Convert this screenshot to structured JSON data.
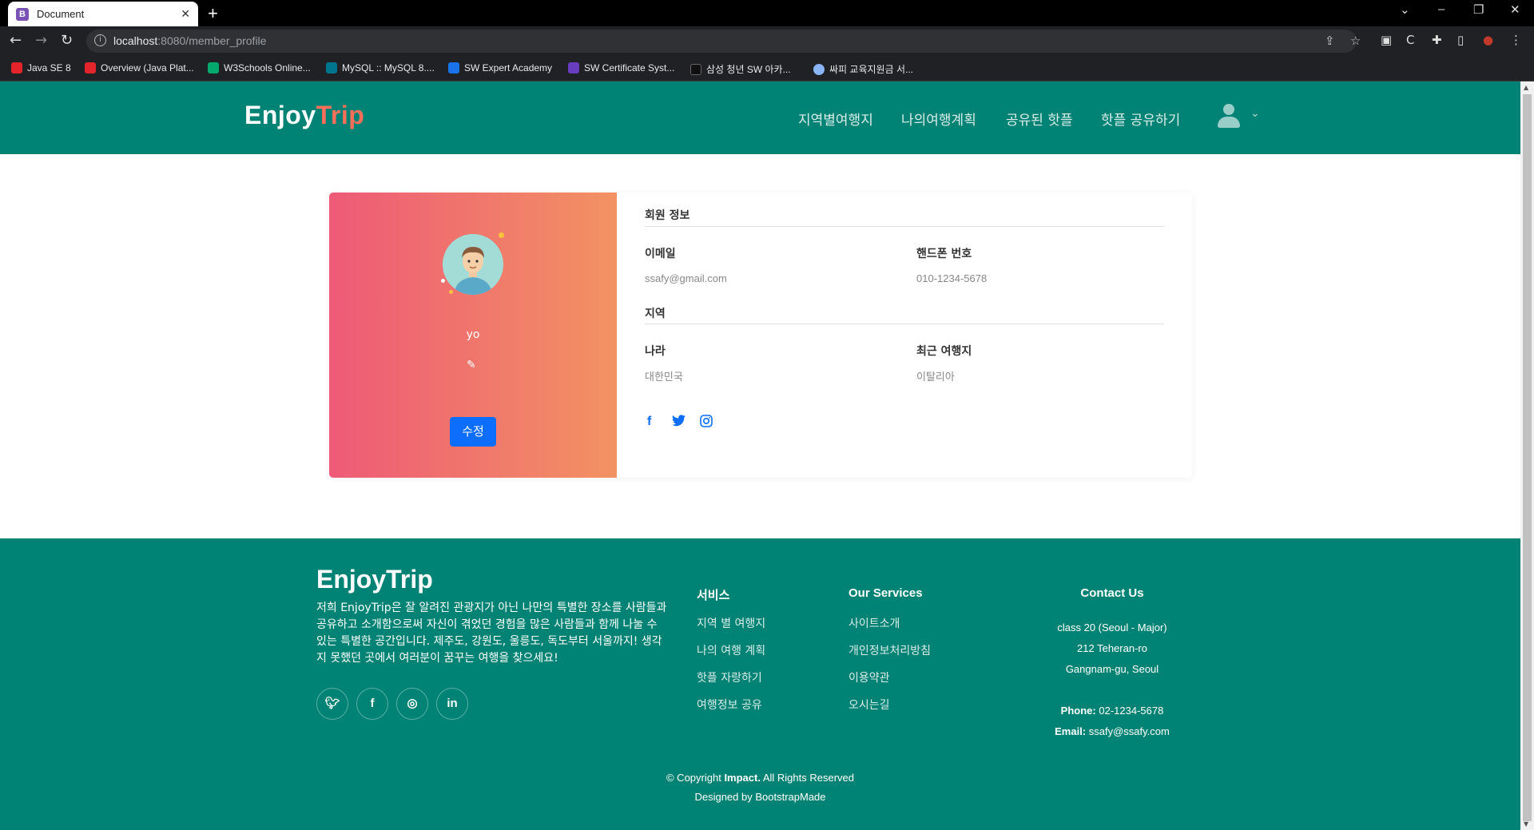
{
  "browser": {
    "tab_title": "Document",
    "tab_favicon": "B",
    "url_host": "localhost",
    "url_rest": ":8080/member_profile",
    "bookmarks": [
      {
        "label": "Java SE 8",
        "color": "#e3242b"
      },
      {
        "label": "Overview (Java Plat...",
        "color": "#e3242b"
      },
      {
        "label": "W3Schools Online...",
        "color": "#04aa6d"
      },
      {
        "label": "MySQL :: MySQL 8....",
        "color": "#00758f"
      },
      {
        "label": "SW Expert Academy",
        "color": "#1a73e8"
      },
      {
        "label": "SW Certificate Syst...",
        "color": "#6a3cc0"
      },
      {
        "label": "삼성 청년 SW 아카...",
        "color": "#111111"
      },
      {
        "label": "싸피 교육지원금 서...",
        "color": "#8ab4f8"
      }
    ]
  },
  "header": {
    "logo_main": "Enjoy",
    "logo_accent": "Trip",
    "nav": [
      "지역별여행지",
      "나의여행계획",
      "공유된 핫플",
      "핫플 공유하기"
    ]
  },
  "profile": {
    "username": "yo",
    "edit_button": "수정",
    "section_member": "회원 정보",
    "email_label": "이메일",
    "email_value": "ssafy@gmail.com",
    "phone_label": "핸드폰 번호",
    "phone_value": "010-1234-5678",
    "section_region": "지역",
    "country_label": "나라",
    "country_value": "대한민국",
    "recent_label": "최근 여행지",
    "recent_value": "이탈리아",
    "social_icons": [
      "facebook-icon",
      "twitter-icon",
      "instagram-icon"
    ]
  },
  "footer": {
    "logo": "EnjoyTrip",
    "description": "저희 EnjoyTrip은 잘 알려진 관광지가 아닌 나만의 특별한 장소를 사람들과 공유하고 소개함으로써 자신이 겪었던 경험을 많은 사람들과 함께 나눌 수 있는 특별한 공간입니다. 제주도, 강원도, 울릉도, 독도부터 서울까지! 생각지 못했던 곳에서 여러분이 꿈꾸는 여행을 찾으세요!",
    "social_icons": [
      "twitter-icon",
      "facebook-icon",
      "instagram-icon",
      "linkedin-icon"
    ],
    "services_title": "서비스",
    "services": [
      "지역 별 여행지",
      "나의 여행 계획",
      "핫플 자랑하기",
      "여행정보 공유"
    ],
    "our_services_title": "Our Services",
    "our_services": [
      "사이트소개",
      "개인정보처리방침",
      "이용약관",
      "오시는길"
    ],
    "contact_title": "Contact Us",
    "address1": "class 20 (Seoul - Major)",
    "address2": "212 Teheran-ro",
    "address3": "Gangnam-gu, Seoul",
    "phone_label": "Phone:",
    "phone": "02-1234-5678",
    "email_label": "Email:",
    "email": "ssafy@ssafy.com",
    "copyright_pre": "© Copyright ",
    "copyright_brand": "Impact.",
    "copyright_post": " All Rights Reserved",
    "designed_by": "Designed by BootstrapMade"
  },
  "colors": {
    "header_bg": "#008374",
    "accent": "#f96f59",
    "button": "#0d6efd"
  }
}
